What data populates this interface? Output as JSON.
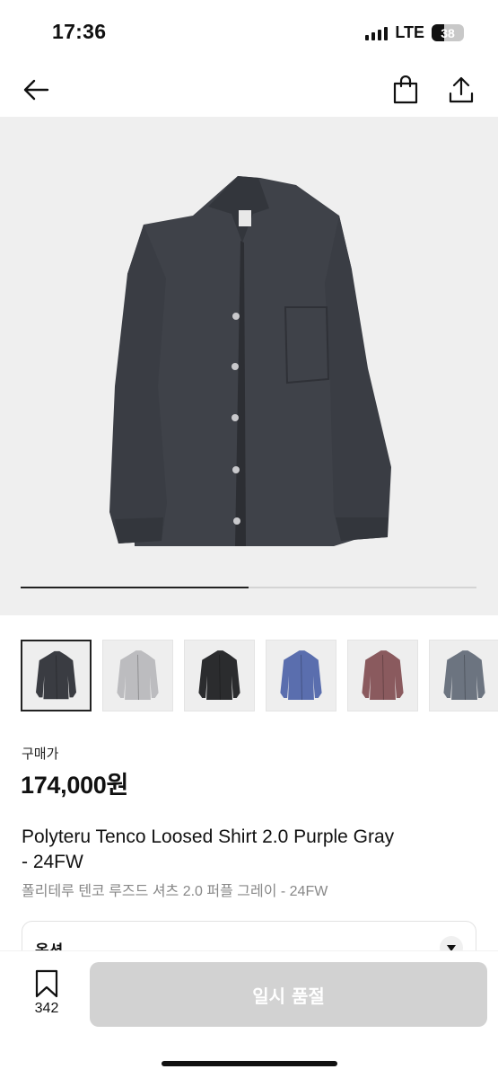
{
  "status_bar": {
    "time": "17:36",
    "network": "LTE",
    "battery": "38",
    "battery_level": 0.38
  },
  "nav": {
    "back_icon": "arrow-left-icon",
    "bag_icon": "shopping-bag-icon",
    "share_icon": "share-icon"
  },
  "gallery": {
    "progress": 0.5,
    "colors": {
      "shirt": "#3f4249",
      "background": "#efefef"
    }
  },
  "thumbnails": [
    {
      "color": "#3a3c42",
      "selected": true
    },
    {
      "color": "#bcbcbf",
      "selected": false
    },
    {
      "color": "#2b2c2e",
      "selected": false
    },
    {
      "color": "#5a6eae",
      "selected": false
    },
    {
      "color": "#8a5a5e",
      "selected": false
    },
    {
      "color": "#6c7480",
      "selected": false
    }
  ],
  "product": {
    "price_label": "구매가",
    "price": "174,000원",
    "title_line1": "Polyteru Tenco Loosed Shirt 2.0 Purple Gray",
    "title_line2": "- 24FW",
    "title_ko": "폴리테루 텐코 루즈드 셔츠 2.0 퍼플 그레이 - 24FW"
  },
  "options": {
    "label": "옵션"
  },
  "bottom": {
    "wish_count": "342",
    "soldout_label": "일시 품절"
  }
}
